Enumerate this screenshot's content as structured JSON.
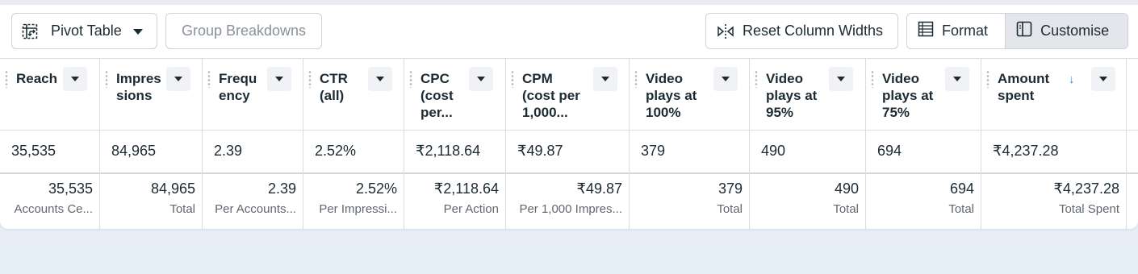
{
  "toolbar": {
    "pivot_label": "Pivot Table",
    "group_label": "Group Breakdowns",
    "reset_label": "Reset Column Widths",
    "format_label": "Format",
    "customise_label": "Customise"
  },
  "columns": [
    {
      "header": "Reach",
      "value": "35,535",
      "total": "35,535",
      "total_label": "Accounts Ce..."
    },
    {
      "header": "Impres\nsions",
      "value": "84,965",
      "total": "84,965",
      "total_label": "Total"
    },
    {
      "header": "Frequ\nency",
      "value": "2.39",
      "total": "2.39",
      "total_label": "Per Accounts..."
    },
    {
      "header": "CTR\n(all)",
      "value": "2.52%",
      "total": "2.52%",
      "total_label": "Per Impressi..."
    },
    {
      "header": "CPC\n(cost\nper...",
      "value": "₹2,118.64",
      "total": "₹2,118.64",
      "total_label": "Per Action"
    },
    {
      "header": "CPM\n(cost per\n1,000...",
      "value": "₹49.87",
      "total": "₹49.87",
      "total_label": "Per 1,000 Impres..."
    },
    {
      "header": "Video\nplays at\n100%",
      "value": "379",
      "total": "379",
      "total_label": "Total"
    },
    {
      "header": "Video\nplays at\n95%",
      "value": "490",
      "total": "490",
      "total_label": "Total"
    },
    {
      "header": "Video\nplays at\n75%",
      "value": "694",
      "total": "694",
      "total_label": "Total"
    },
    {
      "header": "Amount\nspent",
      "value": "₹4,237.28",
      "total": "₹4,237.28",
      "total_label": "Total Spent",
      "sorted": "↓"
    }
  ],
  "icons": {
    "pivot": "pivot-table-icon",
    "reset": "column-width-icon",
    "format": "format-table-icon",
    "customise": "customise-panel-icon",
    "caret": "caret-down-icon",
    "sort": "sort-descending-icon"
  },
  "colors": {
    "accent": "#2d88ff",
    "selected_segment": "#e4e6eb",
    "muted_text": "#8a9198"
  }
}
